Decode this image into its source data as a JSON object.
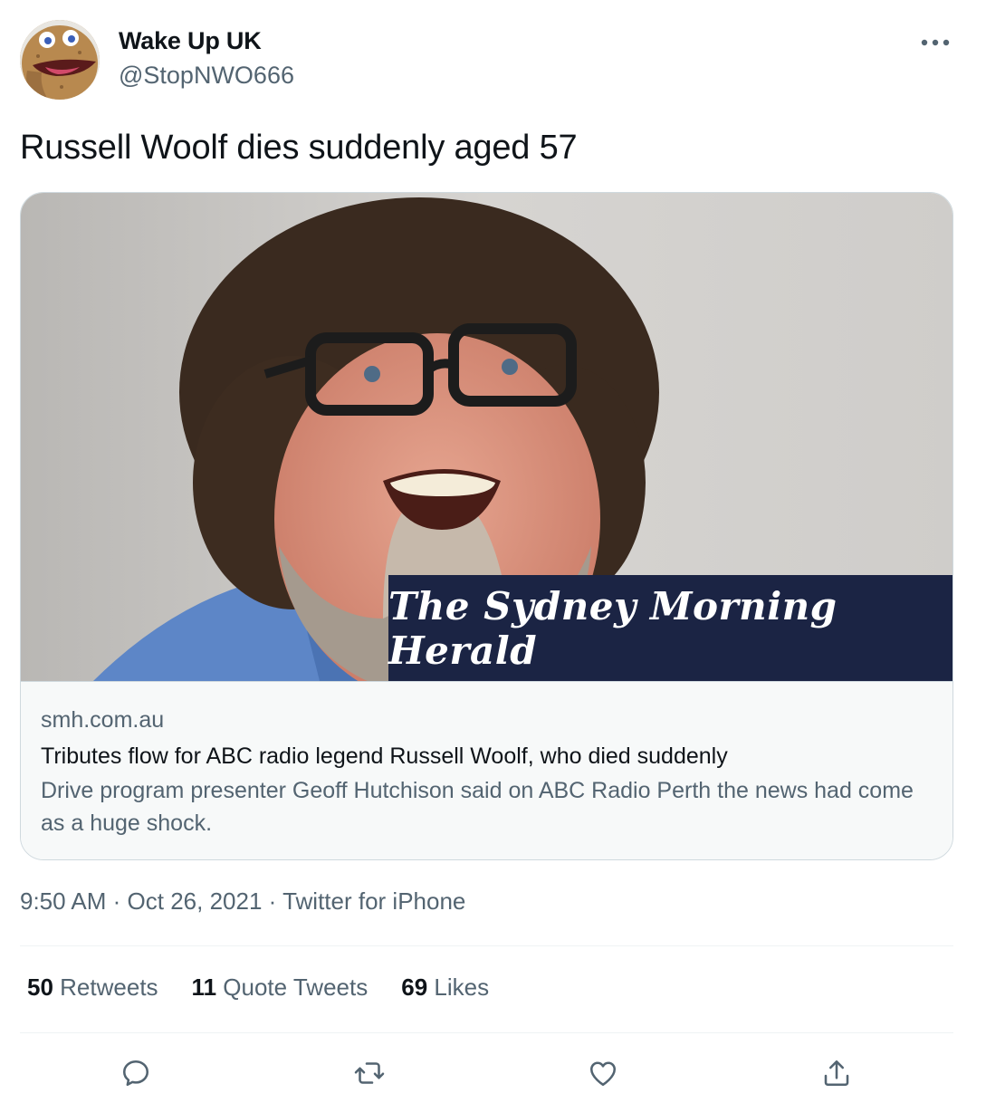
{
  "author": {
    "display_name": "Wake Up UK",
    "handle": "@StopNWO666"
  },
  "tweet": {
    "text": "Russell Woolf dies suddenly aged 57"
  },
  "card": {
    "masthead": "The Sydney Morning Herald",
    "domain": "smh.com.au",
    "title": "Tributes flow for ABC radio legend Russell Woolf, who died suddenly",
    "description": "Drive program presenter Geoff Hutchison said on ABC Radio Perth the news had come as a huge shock."
  },
  "meta": {
    "time": "9:50 AM",
    "date": "Oct 26, 2021",
    "source": "Twitter for iPhone",
    "separator": "·"
  },
  "stats": {
    "retweets_count": "50",
    "retweets_label": "Retweets",
    "quotes_count": "11",
    "quotes_label": "Quote Tweets",
    "likes_count": "69",
    "likes_label": "Likes"
  },
  "icons": {
    "more": "more-horizontal-icon",
    "reply": "reply-icon",
    "retweet": "retweet-icon",
    "like": "heart-icon",
    "share": "share-icon"
  },
  "colors": {
    "text_primary": "#0f1419",
    "text_secondary": "#536471",
    "border": "#cfd9de",
    "masthead_bg": "#1b2444"
  }
}
